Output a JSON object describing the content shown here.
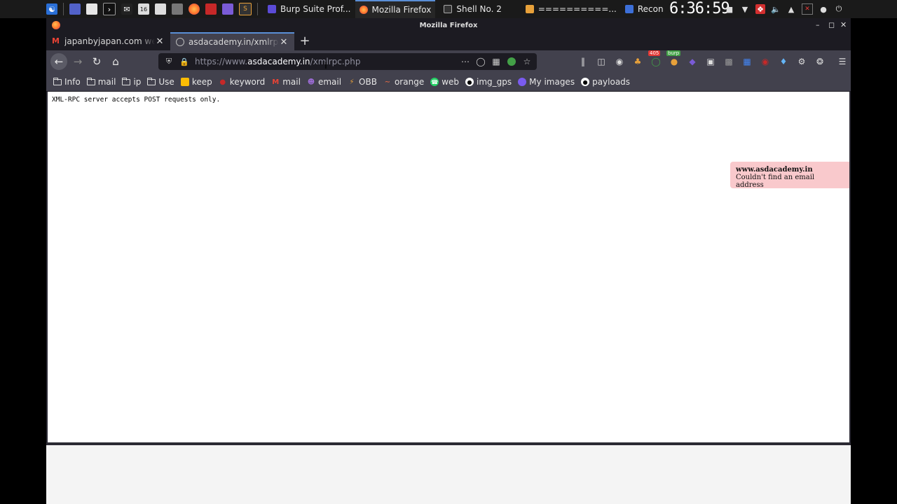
{
  "taskbar": {
    "tasks": [
      {
        "label": "Burp Suite Prof...",
        "active": false,
        "color": "#5b4bd6"
      },
      {
        "label": "Mozilla Firefox",
        "active": true,
        "color": "#ff7139"
      },
      {
        "label": "Shell No. 2",
        "active": false,
        "color": "#888888"
      },
      {
        "label": "==========...",
        "active": false,
        "color": "#e8a13a"
      },
      {
        "label": "Recon",
        "active": false,
        "color": "#3c6fd8"
      }
    ],
    "clock": "6:36:59"
  },
  "window": {
    "title": "Mozilla Firefox"
  },
  "tabs": [
    {
      "label": "japanbyjapan.com websit",
      "selected": false,
      "favicon": "gmail-icon"
    },
    {
      "label": "asdacademy.in/xmlrpc.ph",
      "selected": true,
      "favicon": "globe-icon"
    }
  ],
  "urlbar": {
    "prefix": "https://www.",
    "host": "asdacademy.in",
    "path": "/xmlrpc.php"
  },
  "toolbar": {
    "badge_1": "405",
    "badge_2": "burp"
  },
  "bookmarks": [
    {
      "label": "Info",
      "icon": "folder-icon"
    },
    {
      "label": "mail",
      "icon": "folder-icon"
    },
    {
      "label": "ip",
      "icon": "folder-icon"
    },
    {
      "label": "Use",
      "icon": "folder-icon"
    },
    {
      "label": "keep",
      "icon": "keep-icon"
    },
    {
      "label": "keyword",
      "icon": "keyword-icon"
    },
    {
      "label": "mail",
      "icon": "gmail-icon"
    },
    {
      "label": "email",
      "icon": "email-icon"
    },
    {
      "label": "OBB",
      "icon": "obb-icon"
    },
    {
      "label": "orange",
      "icon": "orange-icon"
    },
    {
      "label": "web",
      "icon": "whatsapp-icon"
    },
    {
      "label": "img_gps",
      "icon": "github-icon"
    },
    {
      "label": "My images",
      "icon": "images-icon"
    },
    {
      "label": "payloads",
      "icon": "github-icon"
    }
  ],
  "page": {
    "message": "XML-RPC server accepts POST requests only."
  },
  "toast": {
    "site": "www.asdacademy.in",
    "message": "Couldn't find an email address"
  }
}
